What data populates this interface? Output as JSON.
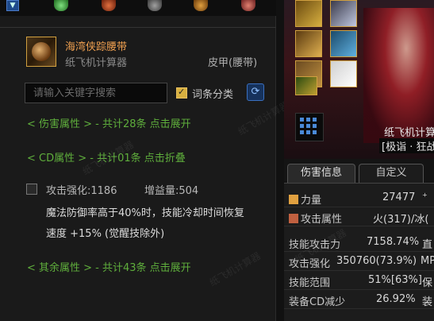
{
  "item": {
    "name": "海湾侠踪腰带",
    "calculator": "纸飞机计算器",
    "type": "皮甲(腰带)"
  },
  "search": {
    "placeholder": "请输入关键字搜索"
  },
  "classify": {
    "label": "词条分类",
    "checked": true
  },
  "groups": {
    "damage": "< 伤害属性 > - 共计28条 点击展开",
    "cd": "< CD属性 > - 共计01条 点击折叠",
    "other": "< 其余属性 > - 共计43条 点击展开"
  },
  "attribute": {
    "name": "攻击强化:1186",
    "increment": "增益量:504",
    "desc_line1": "魔法防御率高于40%时，技能冷却时间恢复",
    "desc_line2": "速度 +15% (觉醒技除外)"
  },
  "character": {
    "name": "纸飞机计算",
    "title": "[极诣 · 狂战"
  },
  "tabs": {
    "damage_info": "伤害信息",
    "custom": "自定义"
  },
  "stats": [
    {
      "label": "力量",
      "value": "27477",
      "extra": "⁺"
    },
    {
      "label": "攻击属性",
      "value": "火(317)/冰(",
      "extra": ""
    },
    {
      "label": "技能攻击力",
      "value": "7158.74%",
      "extra": "直"
    },
    {
      "label": "攻击强化",
      "value": "350760(73.9%)",
      "extra": "MP"
    },
    {
      "label": "技能范围",
      "value": "51%[63%]",
      "extra": "保"
    },
    {
      "label": "装备CD减少",
      "value": "26.92%",
      "extra": "装"
    }
  ],
  "watermark": "纸飞机计算器",
  "colors": {
    "accent_green": "#5fae3c",
    "item_orange": "#f0a050",
    "slot_gold": "#d0a040"
  }
}
